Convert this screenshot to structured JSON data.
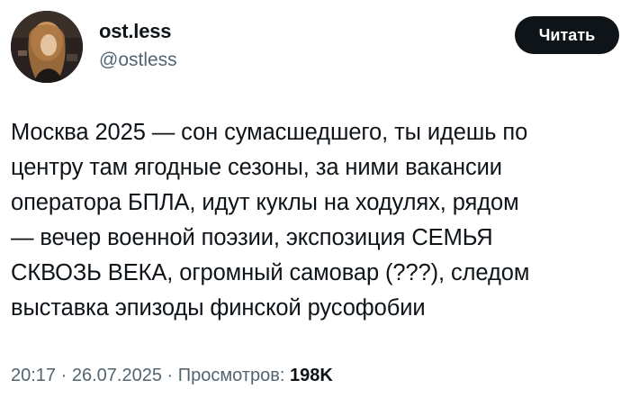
{
  "author": {
    "display_name": "ost.less",
    "handle": "@ostless",
    "avatar_icon": "avatar-photo"
  },
  "follow_button": {
    "label": "Читать"
  },
  "tweet": {
    "lines": [
      "Москва 2025 — сон сумасшедшего, ты идешь по",
      "центру там ягодные сезоны, за ними вакансии",
      "оператора БПЛА, идут куклы на ходулях, рядом",
      "— вечер военной поэзии, экспозиция СЕМЬЯ",
      "СКВОЗЬ ВЕКА, огромный самовар (???), следом",
      "выставка эпизоды финской русофобии"
    ]
  },
  "meta": {
    "time": "20:17",
    "separator": " · ",
    "date": "26.07.2025",
    "views_label": "Просмотров:",
    "views_count": "198K"
  },
  "colors": {
    "text_primary": "#0f1419",
    "text_secondary": "#536471",
    "button_bg": "#0f1419",
    "button_text": "#ffffff",
    "background": "#ffffff"
  }
}
